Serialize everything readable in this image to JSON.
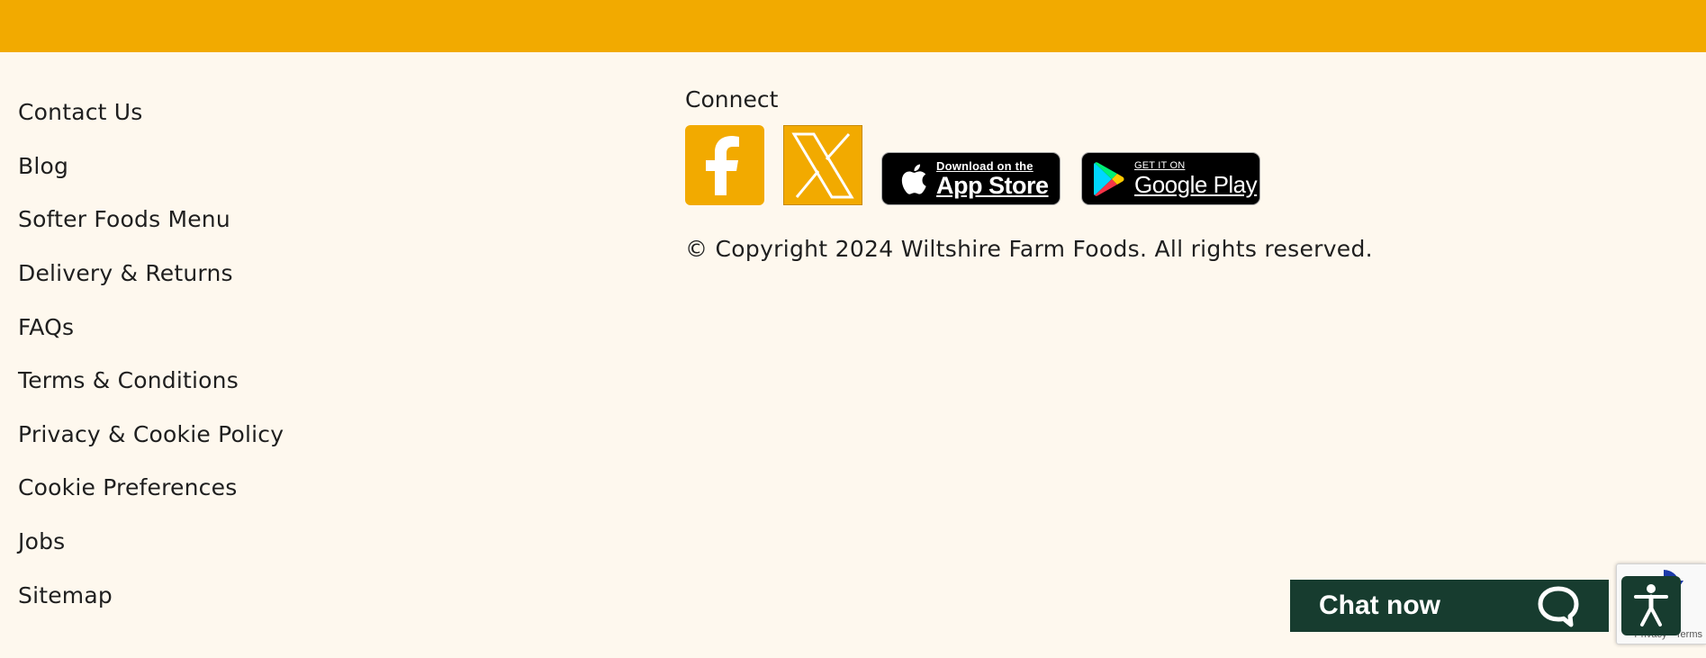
{
  "footer": {
    "links": [
      {
        "label": "Contact Us"
      },
      {
        "label": "Blog"
      },
      {
        "label": "Softer Foods Menu"
      },
      {
        "label": "Delivery & Returns"
      },
      {
        "label": "FAQs"
      },
      {
        "label": "Terms & Conditions"
      },
      {
        "label": "Privacy & Cookie Policy"
      },
      {
        "label": "Cookie Preferences"
      },
      {
        "label": "Jobs"
      },
      {
        "label": "Sitemap"
      }
    ],
    "connect": {
      "title": "Connect",
      "social": [
        {
          "icon": "facebook-icon",
          "color": "#f2aa00"
        },
        {
          "icon": "x-twitter-icon",
          "color": "#f2aa00"
        }
      ],
      "app_store": {
        "small": "Download on the",
        "big": "App Store",
        "icon": "apple-icon"
      },
      "google_play": {
        "small": "GET IT ON",
        "big": "Google Play",
        "icon": "google-play-icon"
      }
    },
    "copyright": "© Copyright 2024 Wiltshire Farm Foods. All rights reserved."
  },
  "chat": {
    "label": "Chat now",
    "icon": "chat-bubble-icon"
  },
  "recaptcha": {
    "text": "Privacy - Terms",
    "icon": "recaptcha-icon"
  },
  "accessibility": {
    "icon": "accessibility-icon"
  },
  "colors": {
    "brand_band": "#f2aa00",
    "background": "#fef8ee",
    "chat_bg": "#173c2f",
    "text": "#1f1f1f"
  }
}
